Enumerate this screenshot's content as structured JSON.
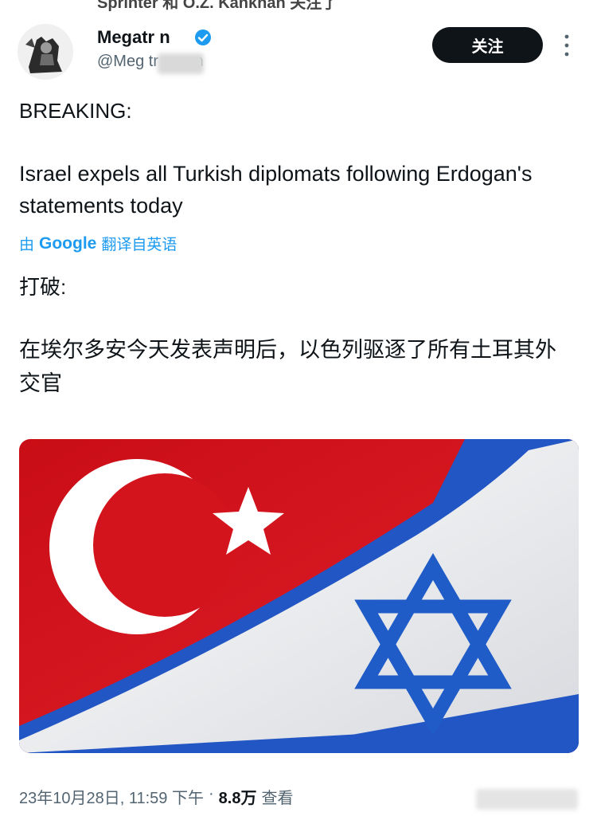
{
  "post": {
    "header_fragment": "Sprinter 和 O.Z. Kankhan 关注了",
    "author": {
      "display_name": "Megatr n",
      "handle": "@Meg tr n_ron",
      "verified": true
    },
    "follow_label": "关注",
    "original_text": {
      "heading": "BREAKING:",
      "body": "Israel expels all Turkish diplomats following Erdogan's statements today"
    },
    "translation_note": {
      "prefix": "由",
      "provider": "Google",
      "suffix": "翻译自英语"
    },
    "translated_text": {
      "heading": "打破:",
      "body": "在埃尔多安今天发表声明后，以色列驱逐了所有土耳其外交官"
    },
    "timestamp": "23年10月28日, 11:59 下午",
    "separator": "·",
    "views_count": "8.8万",
    "views_label": "查看"
  },
  "colors": {
    "accent": "#1d9bf0",
    "turkey_red": "#d0131b",
    "israel_blue": "#1f5cc8"
  },
  "icons": {
    "verified": "verified-badge-icon",
    "more": "more-vertical-icon",
    "avatar": "avatar-image"
  }
}
